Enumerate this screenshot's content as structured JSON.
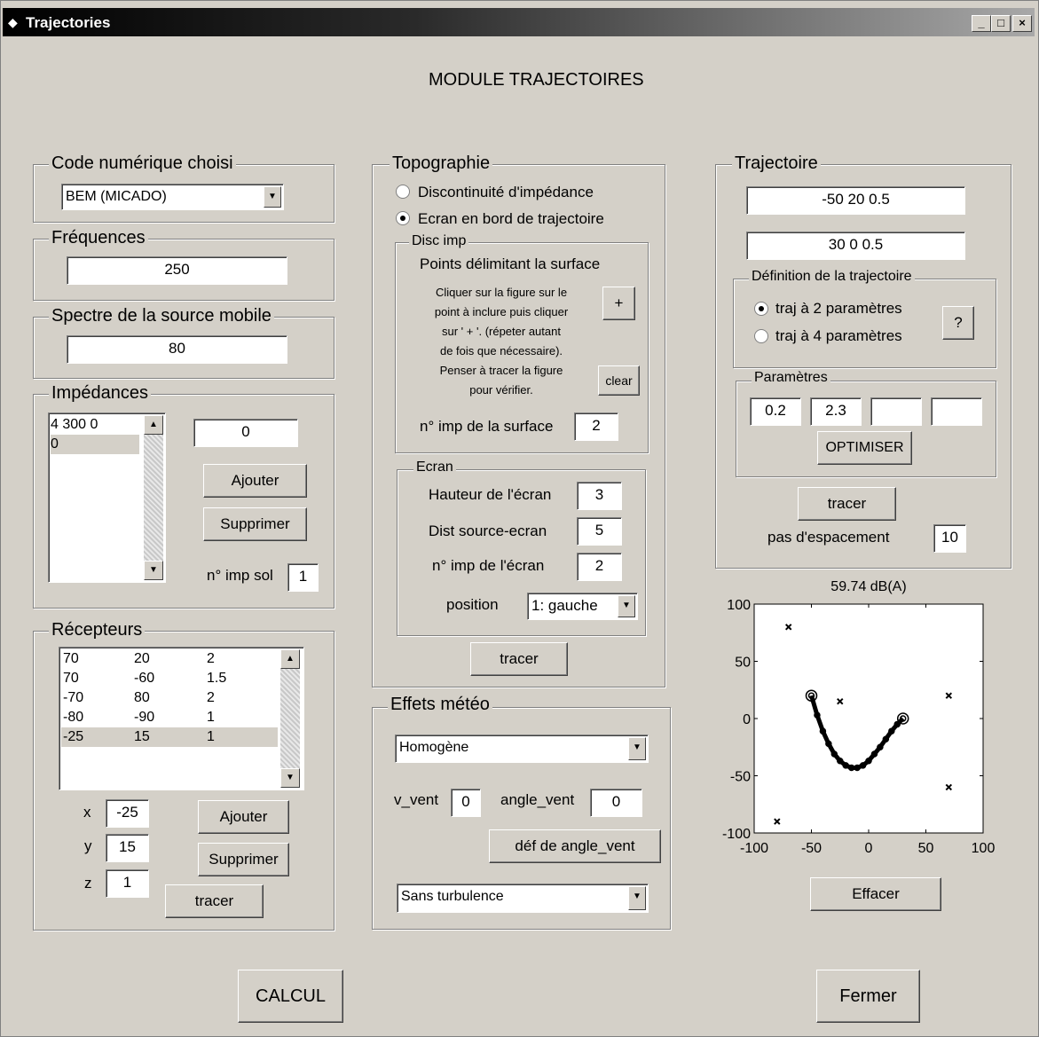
{
  "window": {
    "title": "Trajectories",
    "minimize": "_",
    "maximize": "□",
    "close": "×"
  },
  "heading": "MODULE TRAJECTOIRES",
  "code": {
    "legend": "Code numérique choisi",
    "selected": "BEM (MICADO)"
  },
  "frequences": {
    "legend": "Fréquences",
    "value": "250"
  },
  "spectre": {
    "legend": "Spectre de la source mobile",
    "value": "80"
  },
  "impedances": {
    "legend": "Impédances",
    "list": [
      "4 300 0",
      "0"
    ],
    "value": "0",
    "add": "Ajouter",
    "remove": "Supprimer",
    "n_label": "n° imp sol",
    "n_value": "1"
  },
  "recepteurs": {
    "legend": "Récepteurs",
    "rows": [
      [
        "70",
        "20",
        "2"
      ],
      [
        "70",
        "-60",
        "1.5"
      ],
      [
        "-70",
        "80",
        "2"
      ],
      [
        "-80",
        "-90",
        "1"
      ],
      [
        "-25",
        "15",
        "1"
      ]
    ],
    "x_label": "x",
    "x": "-25",
    "y_label": "y",
    "y": "15",
    "z_label": "z",
    "z": "1",
    "add": "Ajouter",
    "remove": "Supprimer",
    "trace": "tracer"
  },
  "topo": {
    "legend": "Topographie",
    "opt1": "Discontinuité d'impédance",
    "opt2": "Ecran en bord de trajectoire",
    "disc": {
      "legend": "Disc imp",
      "title": "Points délimitant la surface",
      "instr": [
        "Cliquer sur la figure sur le",
        "point à inclure puis cliquer",
        "sur ' + '. (répeter autant",
        "de fois que nécessaire).",
        "Penser à tracer la figure",
        "pour vérifier."
      ],
      "plus": "+",
      "clear": "clear",
      "n_label": "n° imp de la surface",
      "n_value": "2"
    },
    "ecran": {
      "legend": "Ecran",
      "h_label": "Hauteur de l'écran",
      "h_value": "3",
      "d_label": "Dist source-ecran",
      "d_value": "5",
      "n_label": "n° imp de l'écran",
      "n_value": "2",
      "pos_label": "position",
      "pos_value": "1: gauche"
    },
    "trace": "tracer"
  },
  "meteo": {
    "legend": "Effets météo",
    "profile": "Homogène",
    "v_label": "v_vent",
    "v_value": "0",
    "a_label": "angle_vent",
    "a_value": "0",
    "def_btn": "déf de angle_vent",
    "turb": "Sans turbulence"
  },
  "traj": {
    "legend": "Trajectoire",
    "p1": "-50 20 0.5",
    "p2": "30 0 0.5",
    "def": {
      "legend": "Définition de la trajectoire",
      "opt1": "traj à 2 paramètres",
      "opt2": "traj à 4 paramètres",
      "help": "?"
    },
    "params": {
      "legend": "Paramètres",
      "values": [
        "0.2",
        "2.3",
        "",
        ""
      ],
      "optimize": "OPTIMISER"
    },
    "trace": "tracer",
    "pas_label": "pas d'espacement",
    "pas_value": "10"
  },
  "chart_data": {
    "type": "scatter",
    "title": "59.74 dB(A)",
    "xlim": [
      -100,
      100
    ],
    "ylim": [
      -100,
      100
    ],
    "xticks": [
      "-100",
      "-50",
      "0",
      "50",
      "100"
    ],
    "yticks": [
      "100",
      "50",
      "0",
      "-50",
      "-100"
    ],
    "grid": false,
    "receivers": [
      [
        70,
        20
      ],
      [
        70,
        -60
      ],
      [
        -70,
        80
      ],
      [
        -80,
        -90
      ],
      [
        -25,
        15
      ]
    ],
    "endpoints": [
      [
        -50,
        20
      ],
      [
        30,
        0
      ]
    ],
    "trajectory_x": [
      -50,
      -45,
      -40,
      -35,
      -30,
      -25,
      -20,
      -15,
      -10,
      -5,
      0,
      5,
      10,
      15,
      20,
      25,
      30
    ],
    "trajectory_y": [
      20,
      3,
      -11,
      -22,
      -31,
      -37,
      -41,
      -43,
      -43,
      -41,
      -37,
      -31,
      -25,
      -18,
      -11,
      -5,
      0
    ]
  },
  "effacer": "Effacer",
  "calcul": "CALCUL",
  "fermer": "Fermer"
}
